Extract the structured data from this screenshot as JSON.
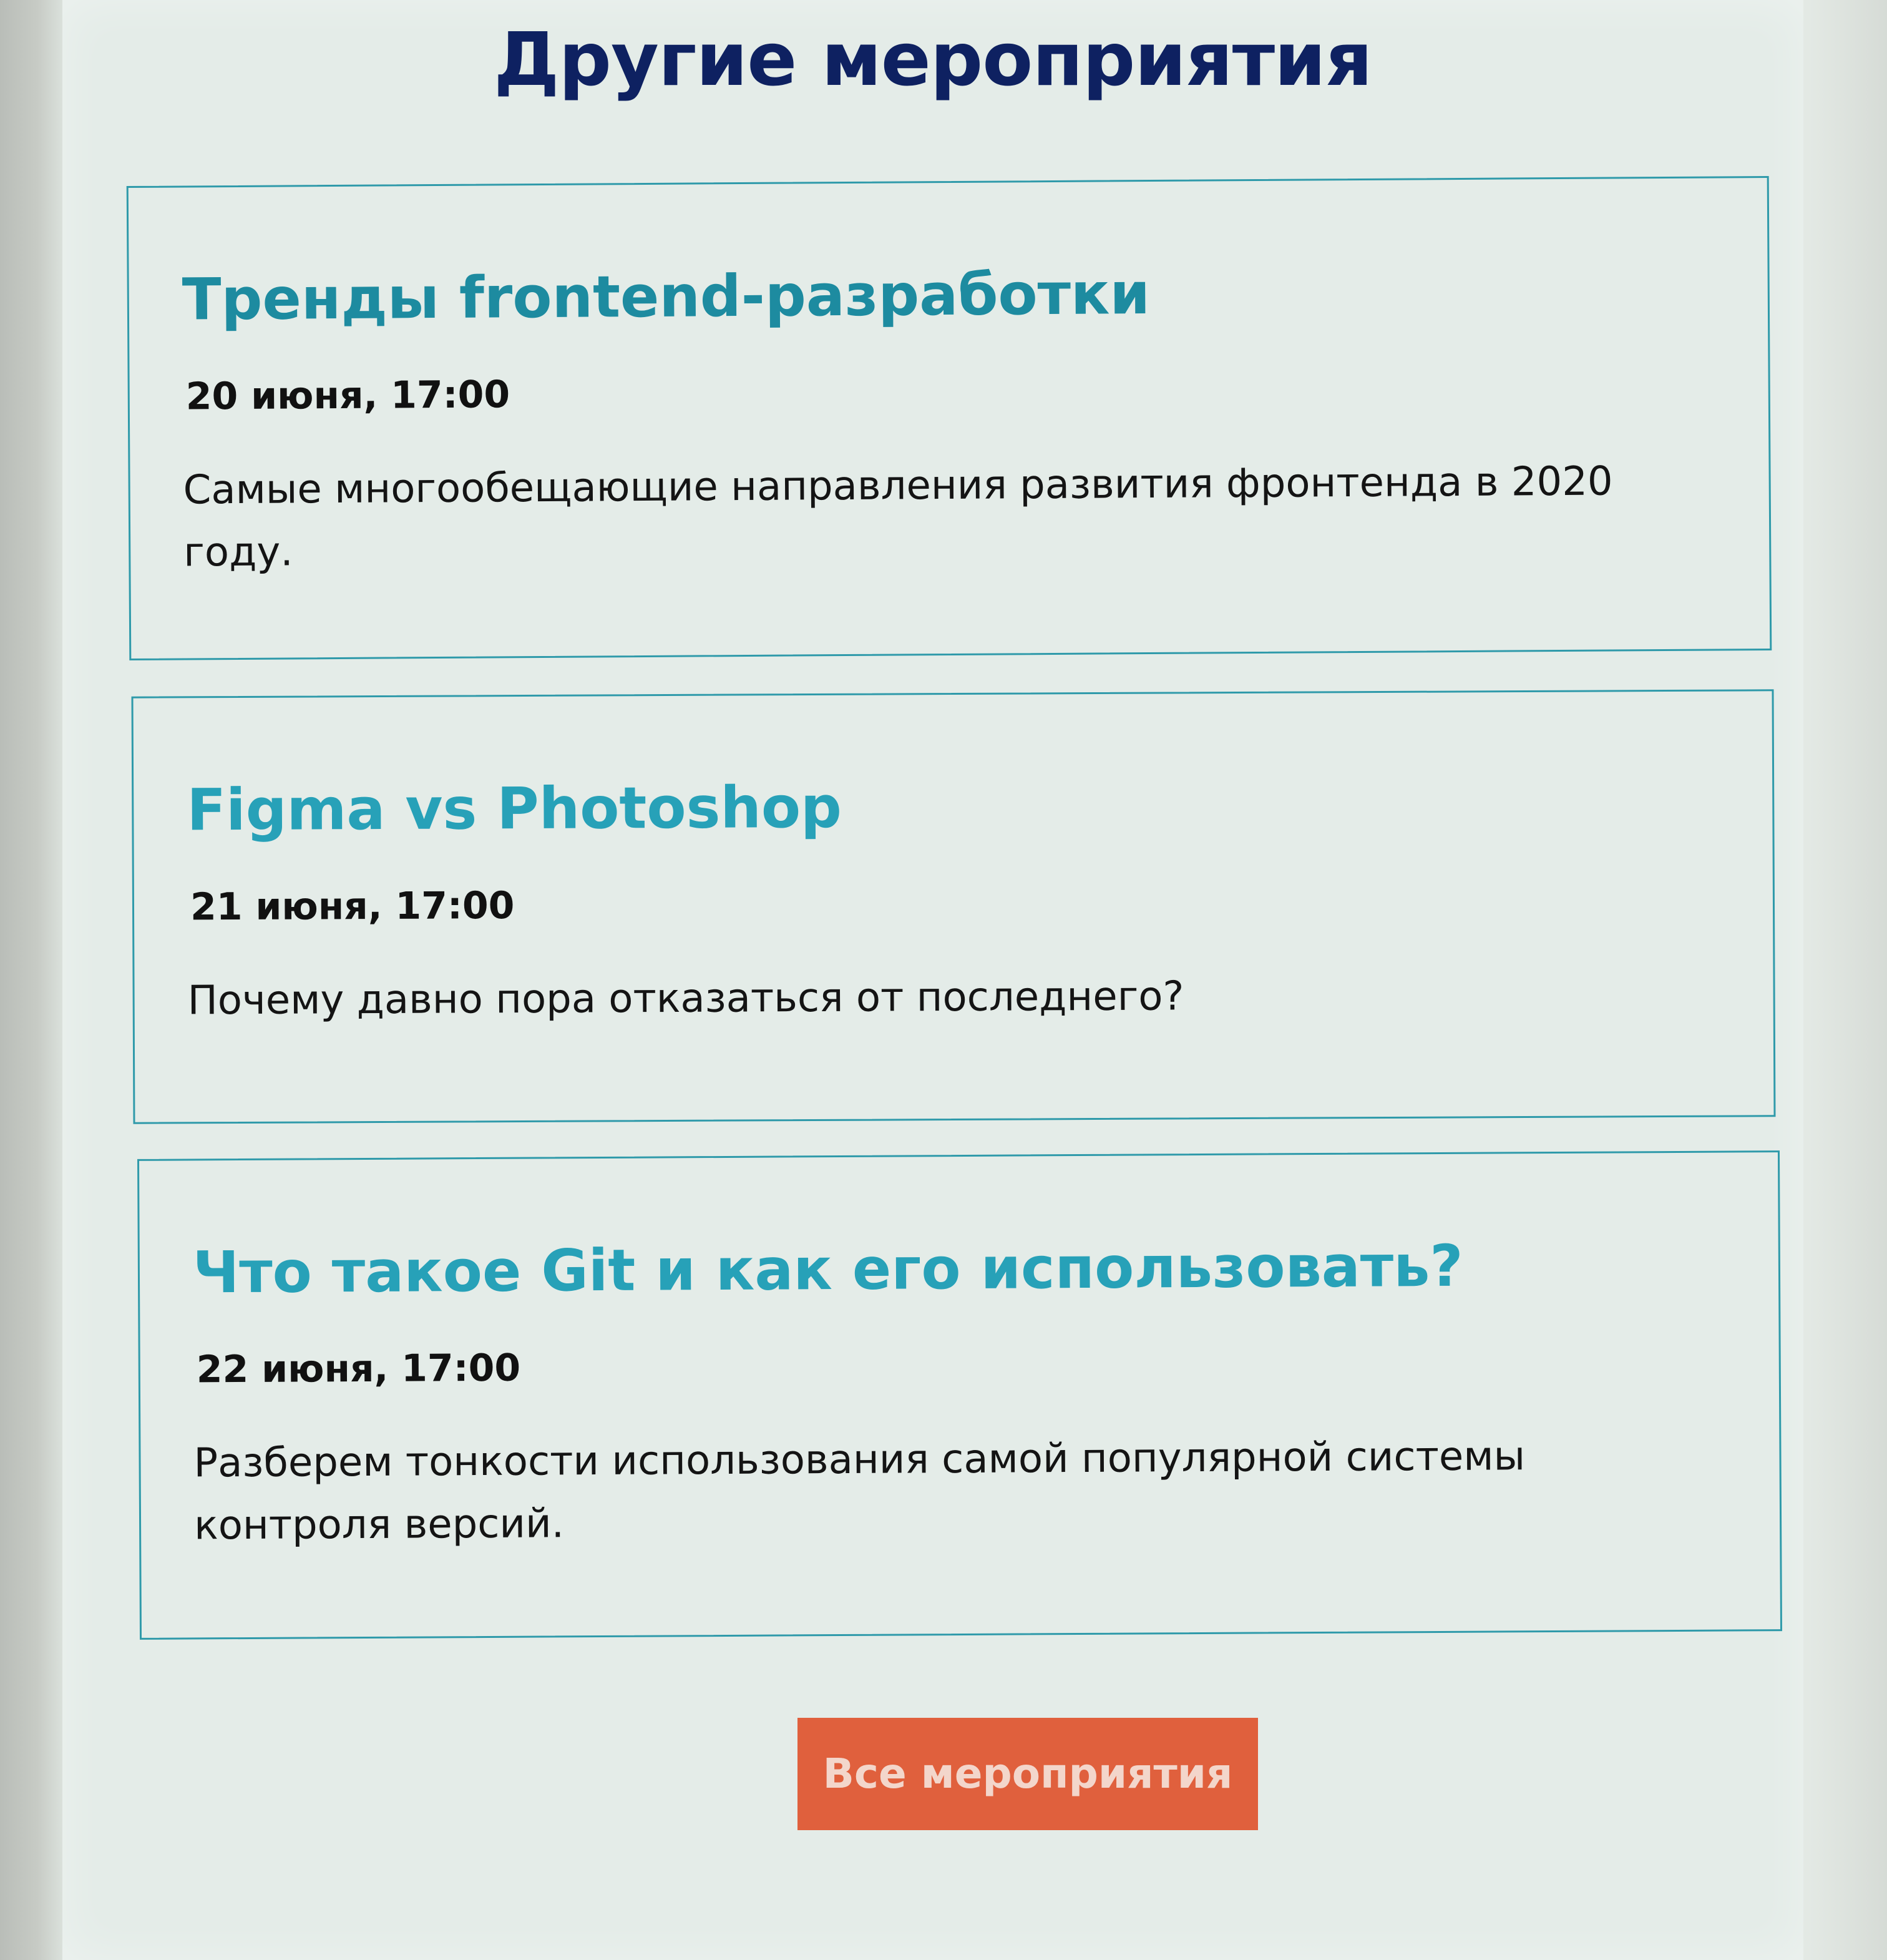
{
  "page": {
    "title": "Другие мероприятия"
  },
  "events": [
    {
      "title": "Тренды frontend-разработки",
      "date": "20 июня, 17:00",
      "description": "Самые многообещающие направления развития фронтенда в 2020 году."
    },
    {
      "title": "Figma vs Photoshop",
      "date": "21 июня, 17:00",
      "description": "Почему давно пора отказаться от последнего?"
    },
    {
      "title": "Что такое Git и как его использовать?",
      "date": "22 июня, 17:00",
      "description": "Разберем тонкости использования самой популярной системы контроля версий."
    }
  ],
  "actions": {
    "all_events_label": "Все мероприятия"
  },
  "colors": {
    "heading": "#0e2161",
    "card_title": "#1d8ba0",
    "card_border": "#2f9aaa",
    "button": "#e0603d"
  }
}
